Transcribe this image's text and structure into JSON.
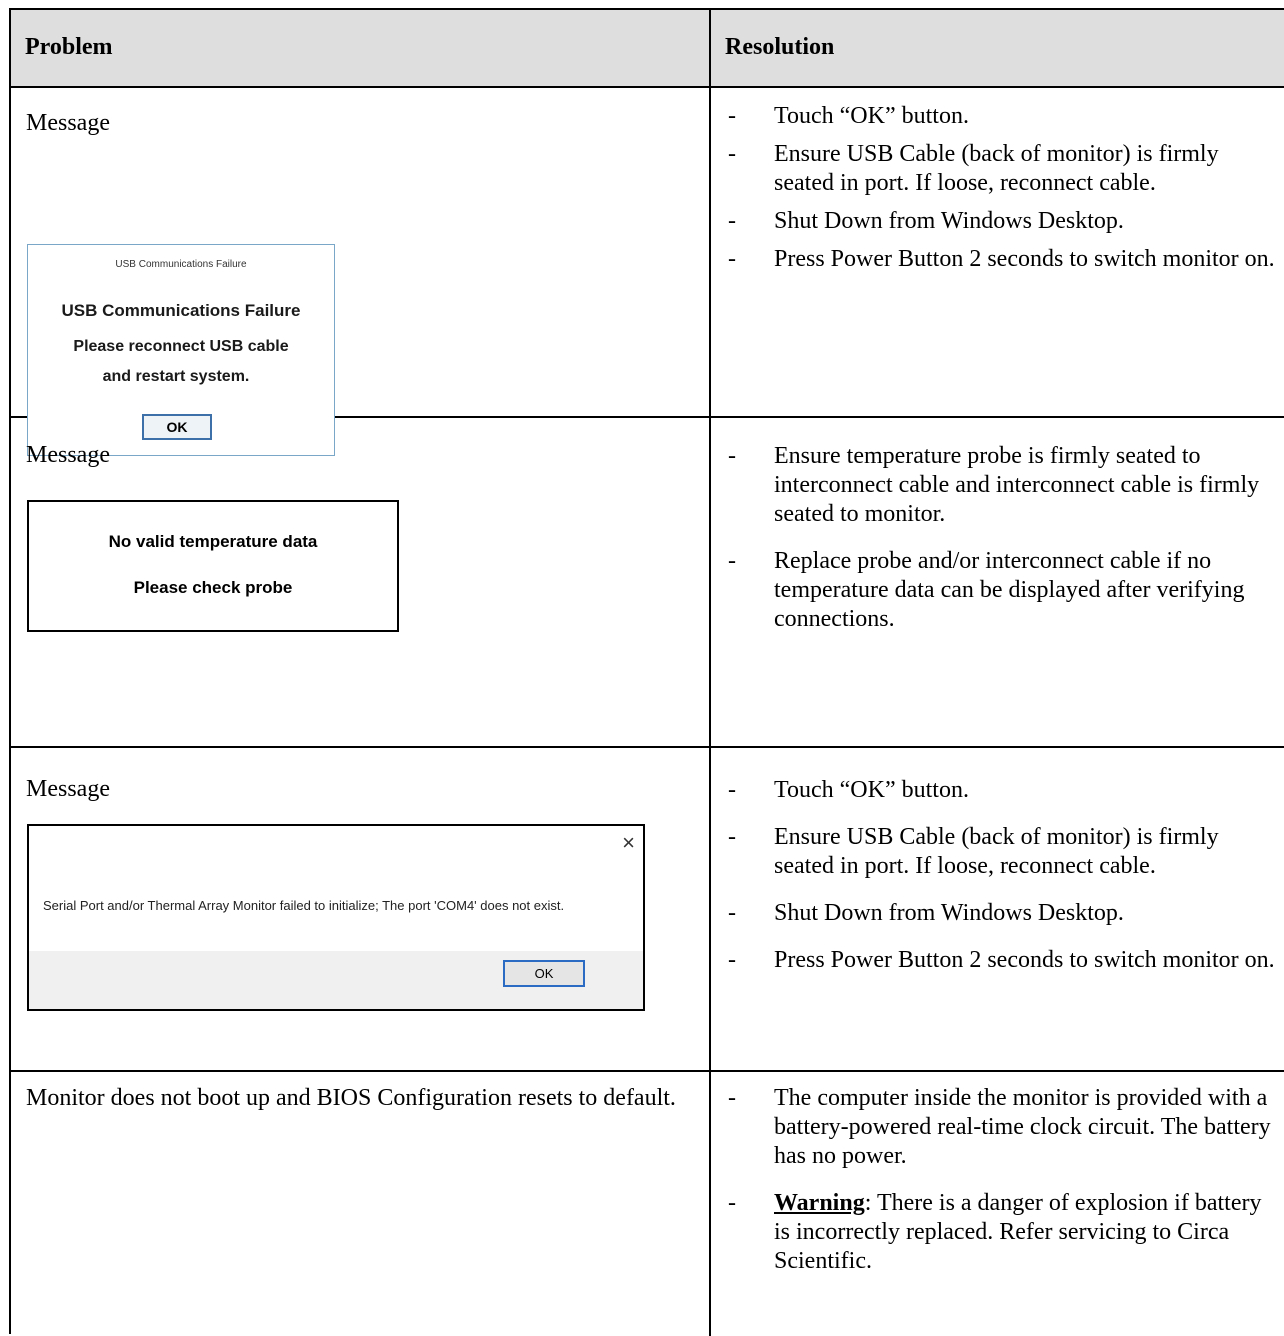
{
  "header": {
    "problem": "Problem",
    "resolution": "Resolution"
  },
  "rows": [
    {
      "problem_label": "Message",
      "dialog": {
        "title": "USB Communications Failure",
        "heading": "USB Communications Failure",
        "line1": "Please reconnect USB cable",
        "line2": "and restart system.",
        "ok": "OK"
      },
      "resolution": [
        "Touch “OK” button.",
        "Ensure USB Cable (back of monitor) is firmly seated in port. If loose, reconnect cable.",
        "Shut Down from Windows Desktop.",
        "Press Power Button 2 seconds to switch monitor on."
      ]
    },
    {
      "problem_label": "Message",
      "dialog": {
        "line1": "No valid temperature data",
        "line2": "Please check probe"
      },
      "resolution": [
        "Ensure temperature probe is firmly seated to interconnect cable and interconnect cable is firmly seated to monitor.",
        "Replace probe and/or interconnect cable if no temperature data can be displayed after verifying connections."
      ]
    },
    {
      "problem_label": "Message",
      "dialog": {
        "close": "×",
        "body": "Serial Port and/or Thermal Array Monitor failed to initialize; The port 'COM4' does not exist.",
        "ok": "OK"
      },
      "resolution": [
        "Touch “OK” button.",
        "Ensure USB Cable (back of monitor) is firmly seated in port. If loose, reconnect cable.",
        "Shut Down from Windows Desktop.",
        "Press Power Button 2 seconds to switch monitor on."
      ]
    },
    {
      "problem_text": "Monitor does not boot up and BIOS Configuration resets to default.",
      "resolution": [
        "The computer inside the monitor is provided with a battery-powered real-time clock circuit. The battery has no power."
      ],
      "warning": {
        "label": "Warning",
        "text": ": There is a danger of explosion if battery is incorrectly replaced.  Refer servicing to Circa Scientific."
      }
    }
  ],
  "dash": "-"
}
